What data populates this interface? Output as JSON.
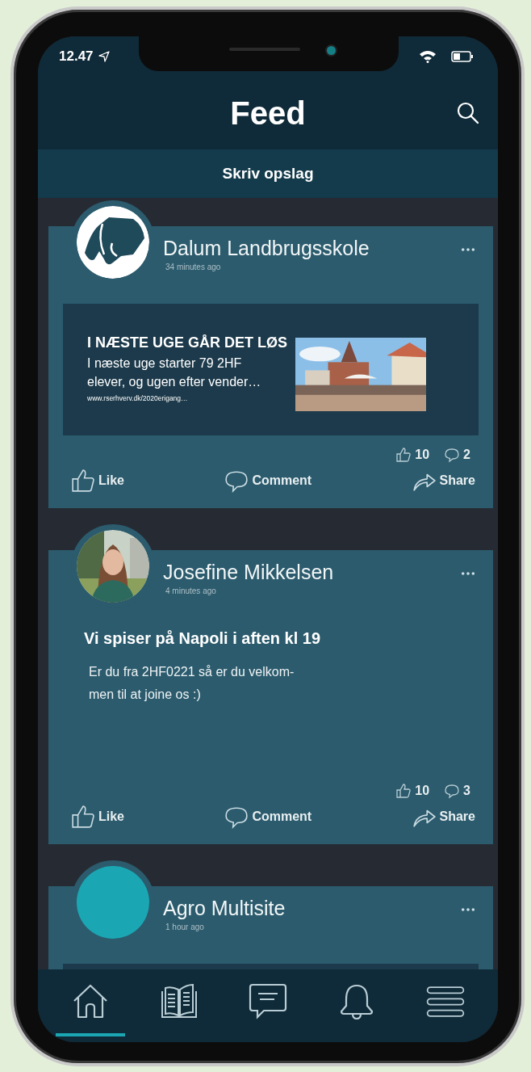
{
  "status_bar": {
    "time": "12.47"
  },
  "header": {
    "title": "Feed"
  },
  "compose": {
    "label": "Skriv opslag"
  },
  "posts": [
    {
      "author": "Dalum Landbrugsskole",
      "time": "34 minutes ago",
      "avatar": {
        "kind": "logo"
      },
      "attachment": {
        "kind": "link",
        "title": "I NÆSTE UGE GÅR DET LØS",
        "lines": [
          "I næste uge starter 79 2HF",
          "elever, og ugen efter vender…"
        ],
        "url": "www.rserhverv.dk/2020erigang…"
      },
      "likes": "10",
      "comments": "2",
      "actions": [
        "Like",
        "Comment",
        "Share"
      ]
    },
    {
      "author": "Josefine Mikkelsen",
      "time": "4 minutes ago",
      "attachment": {
        "kind": "text",
        "title": "Vi spiser på Napoli i aften kl 19",
        "lines": [
          "Er du fra 2HF0221 så er du velkom-",
          "men til at joine os :)"
        ]
      },
      "likes": "10",
      "comments": "3",
      "actions": [
        "Like",
        "Comment",
        "Share"
      ]
    },
    {
      "author": "Agro Multisite",
      "time": "1 hour ago",
      "avatar": {
        "kind": "color",
        "color": "#1aa7b3"
      },
      "attachment": {
        "kind": "link"
      }
    }
  ],
  "nav": [
    {
      "kind": "home",
      "selected": true
    },
    {
      "kind": "book",
      "selected": false
    },
    {
      "kind": "chat",
      "selected": false
    },
    {
      "kind": "bell",
      "selected": false
    },
    {
      "kind": "menu",
      "selected": false
    }
  ]
}
